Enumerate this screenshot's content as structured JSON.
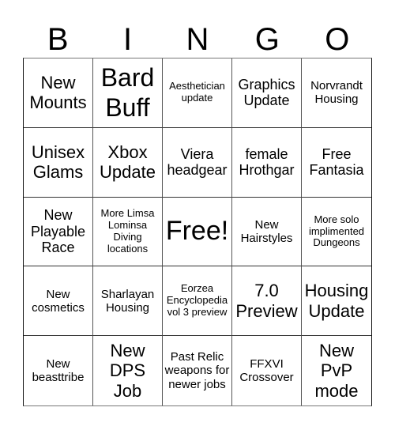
{
  "header": [
    "B",
    "I",
    "N",
    "G",
    "O"
  ],
  "cells": [
    {
      "text": "New Mounts",
      "size": "lg"
    },
    {
      "text": "Bard Buff",
      "size": "xl"
    },
    {
      "text": "Aesthetician update",
      "size": "xs"
    },
    {
      "text": "Graphics Update",
      "size": "md"
    },
    {
      "text": "Norvrandt Housing",
      "size": "sm"
    },
    {
      "text": "Unisex Glams",
      "size": "lg"
    },
    {
      "text": "Xbox Update",
      "size": "lg"
    },
    {
      "text": "Viera headgear",
      "size": "md"
    },
    {
      "text": "female Hrothgar",
      "size": "md"
    },
    {
      "text": "Free Fantasia",
      "size": "md"
    },
    {
      "text": "New Playable Race",
      "size": "md"
    },
    {
      "text": "More Limsa Lominsa Diving locations",
      "size": "xs"
    },
    {
      "text": "Free!",
      "size": "free"
    },
    {
      "text": "New Hairstyles",
      "size": "sm"
    },
    {
      "text": "More solo implimented Dungeons",
      "size": "xs"
    },
    {
      "text": "New cosmetics",
      "size": "sm"
    },
    {
      "text": "Sharlayan Housing",
      "size": "sm"
    },
    {
      "text": "Eorzea Encyclopedia vol 3 preview",
      "size": "xs"
    },
    {
      "text": "7.0 Preview",
      "size": "lg"
    },
    {
      "text": "Housing Update",
      "size": "lg"
    },
    {
      "text": "New beasttribe",
      "size": "sm"
    },
    {
      "text": "New DPS Job",
      "size": "lg"
    },
    {
      "text": "Past Relic weapons for newer jobs",
      "size": "sm"
    },
    {
      "text": "FFXVI Crossover",
      "size": "sm"
    },
    {
      "text": "New PvP mode",
      "size": "lg"
    }
  ]
}
